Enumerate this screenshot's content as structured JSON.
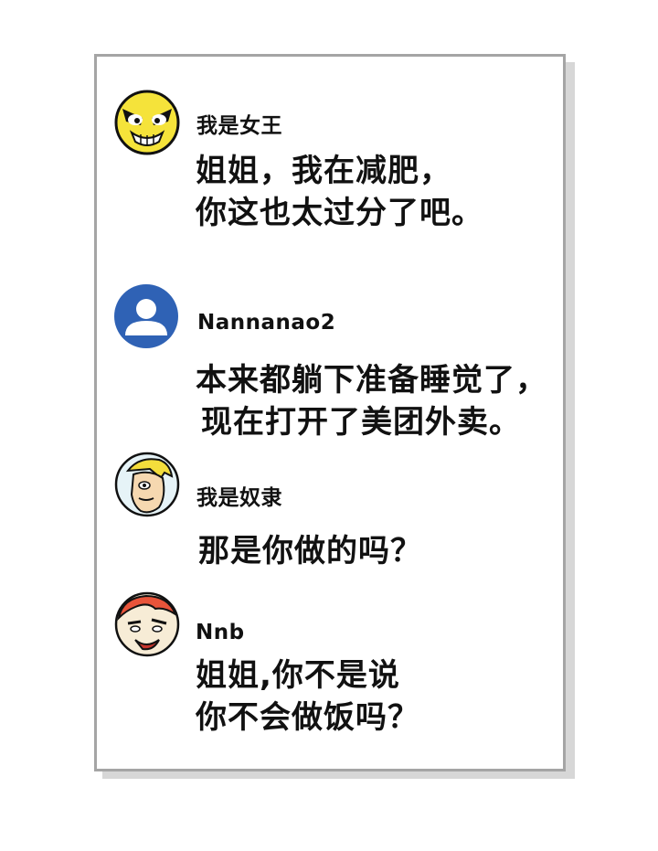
{
  "comments": [
    {
      "username": "我是女王",
      "avatar_icon": "angry-yellow-face-icon",
      "lines": [
        "姐姐，我在减肥，",
        "你这也太过分了吧。"
      ]
    },
    {
      "username": "Nannanao2",
      "avatar_icon": "default-user-icon",
      "lines": [
        "本来都躺下准备睡觉了，",
        "现在打开了美团外卖。"
      ]
    },
    {
      "username": "我是奴隶",
      "avatar_icon": "blonde-man-face-icon",
      "lines": [
        "那是你做的吗？"
      ]
    },
    {
      "username": "Nnb",
      "avatar_icon": "red-hair-woman-face-icon",
      "lines": [
        "姐姐,你不是说",
        "你不会做饭吗？"
      ]
    }
  ],
  "colors": {
    "panel_border": "#a5a5a5",
    "shadow": "#d7d7d7",
    "default_avatar": "#2f62b5",
    "yellow_face": "#f5e33a"
  }
}
